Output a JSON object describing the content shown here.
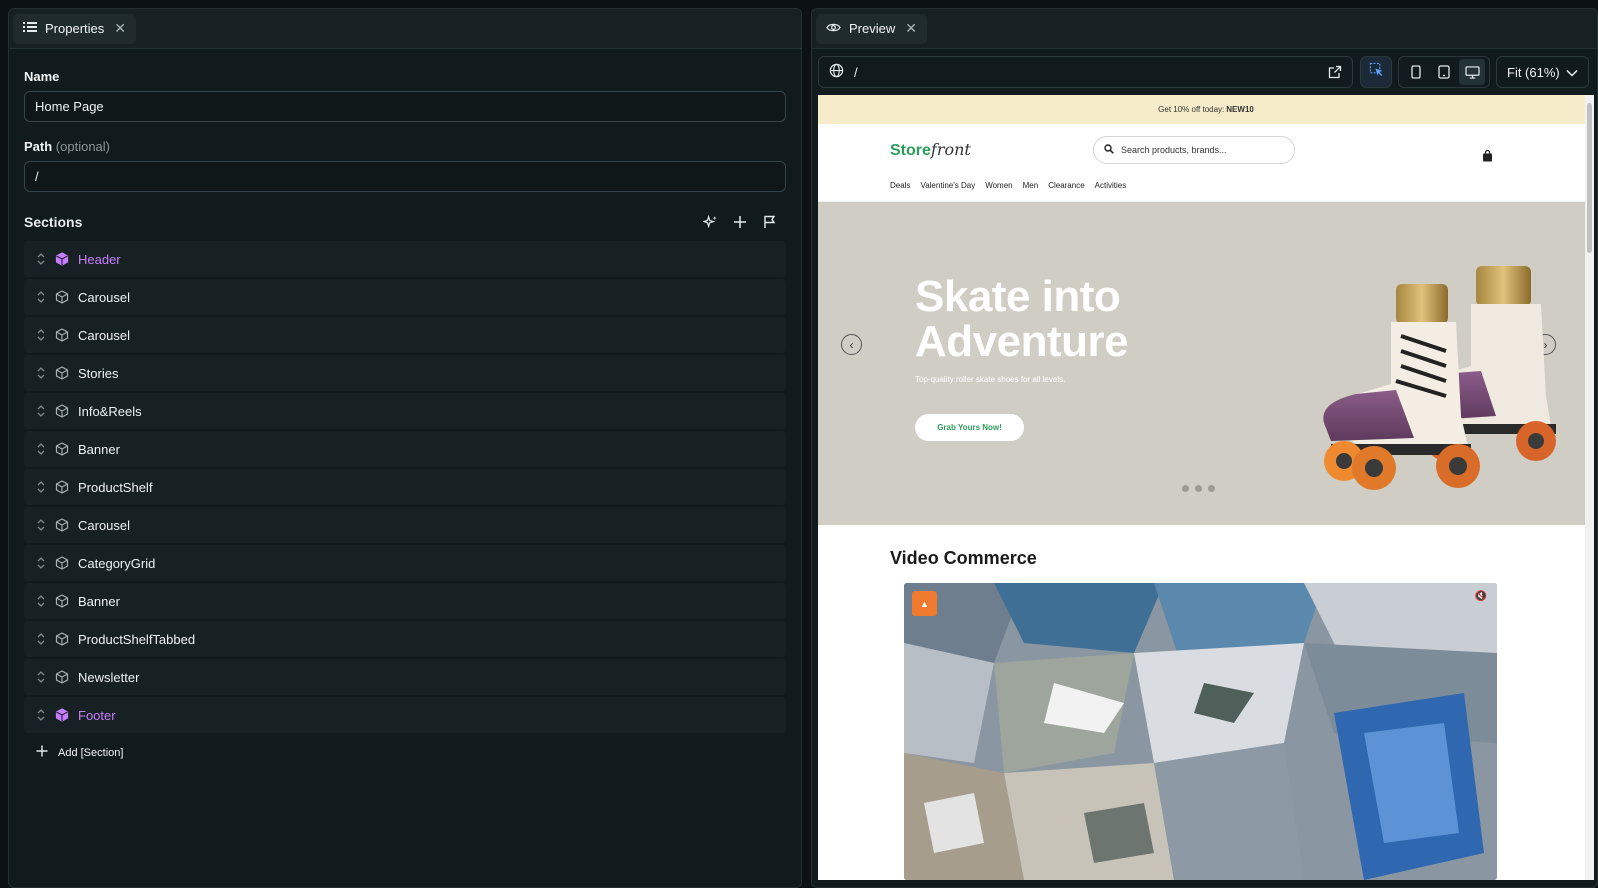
{
  "left_panel": {
    "tab_label": "Properties",
    "name_label": "Name",
    "name_value": "Home Page",
    "path_label": "Path",
    "path_optional": "(optional)",
    "path_value": "/",
    "sections_title": "Sections",
    "sections": [
      {
        "label": "Header",
        "accent": true
      },
      {
        "label": "Carousel",
        "accent": false
      },
      {
        "label": "Carousel",
        "accent": false
      },
      {
        "label": "Stories",
        "accent": false
      },
      {
        "label": "Info&Reels",
        "accent": false
      },
      {
        "label": "Banner",
        "accent": false
      },
      {
        "label": "ProductShelf",
        "accent": false
      },
      {
        "label": "Carousel",
        "accent": false
      },
      {
        "label": "CategoryGrid",
        "accent": false
      },
      {
        "label": "Banner",
        "accent": false
      },
      {
        "label": "ProductShelfTabbed",
        "accent": false
      },
      {
        "label": "Newsletter",
        "accent": false
      },
      {
        "label": "Footer",
        "accent": true
      }
    ],
    "add_section_label": "Add [Section]"
  },
  "right_panel": {
    "tab_label": "Preview",
    "url": "/",
    "zoom_label": "Fit (61%)"
  },
  "site": {
    "promo_text": "Get 10% off today:",
    "promo_code": "NEW10",
    "logo_bold": "Store",
    "logo_italic": "front",
    "search_placeholder": "Search products, brands...",
    "nav": [
      "Deals",
      "Valentine's Day",
      "Women",
      "Men",
      "Clearance",
      "Activities"
    ],
    "hero_title_line1": "Skate into",
    "hero_title_line2": "Adventure",
    "hero_subtitle": "Top-quality roller skate shoes for all levels.",
    "hero_button": "Grab Yours Now!",
    "video_section_title": "Video Commerce"
  },
  "colors": {
    "accent_purple": "#c77dff",
    "brand_green": "#2d9d5c",
    "promo_bg": "#f6ecc9",
    "hero_bg": "#d0cdc5"
  }
}
